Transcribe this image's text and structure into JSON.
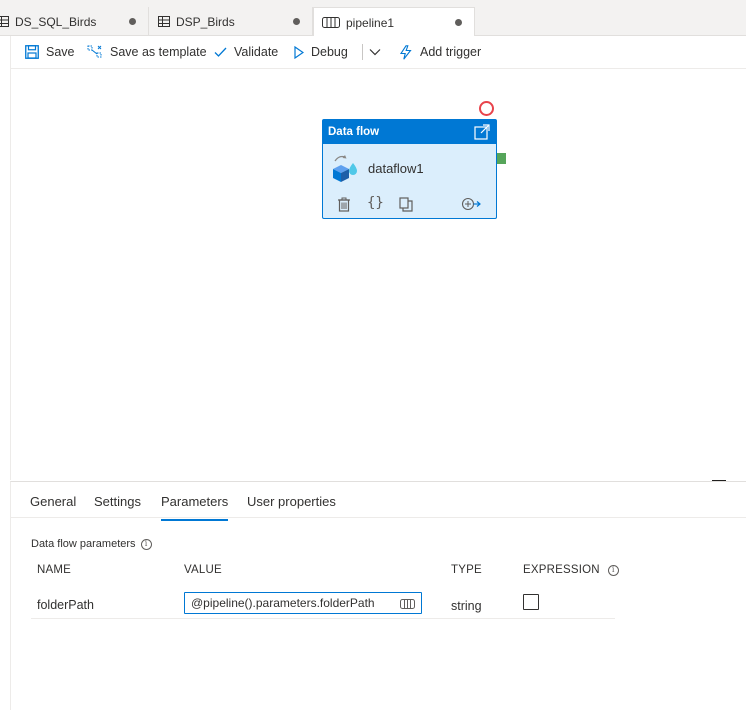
{
  "tabs": [
    {
      "label": "DS_SQL_Birds",
      "icon": "table-icon",
      "modified": true
    },
    {
      "label": "DSP_Birds",
      "icon": "table-icon",
      "modified": true
    },
    {
      "label": "pipeline1",
      "icon": "pipeline-icon",
      "modified": true,
      "active": true
    }
  ],
  "toolbar": {
    "save_label": "Save",
    "save_template_label": "Save as template",
    "validate_label": "Validate",
    "debug_label": "Debug",
    "add_trigger_label": "Add trigger"
  },
  "activity": {
    "type_label": "Data flow",
    "name": "dataflow1"
  },
  "bottom_panel": {
    "tabs": [
      "General",
      "Settings",
      "Parameters",
      "User properties"
    ],
    "active_tab": "Parameters",
    "section_title": "Data flow parameters",
    "columns": {
      "name": "NAME",
      "value": "VALUE",
      "type": "TYPE",
      "expression": "EXPRESSION"
    },
    "rows": [
      {
        "name": "folderPath",
        "value": "@pipeline().parameters.folderPath",
        "type": "string",
        "expression_checked": false
      }
    ]
  },
  "colors": {
    "accent": "#0078d4",
    "activity_fill": "#dbeefc",
    "error_circle": "#e8434b",
    "success_port": "#56a55a"
  }
}
